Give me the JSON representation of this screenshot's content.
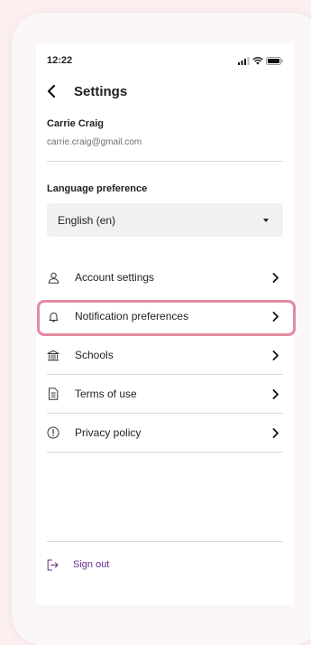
{
  "status_bar": {
    "time": "12:22"
  },
  "header": {
    "title": "Settings"
  },
  "user": {
    "name": "Carrie Craig",
    "email": "carrie.craig@gmail.com"
  },
  "language": {
    "label": "Language preference",
    "selected": "English (en)"
  },
  "menu": {
    "items": [
      {
        "label": "Account settings",
        "icon": "user-icon"
      },
      {
        "label": "Notification preferences",
        "icon": "bell-icon",
        "highlighted": true
      },
      {
        "label": "Schools",
        "icon": "school-building-icon"
      },
      {
        "label": "Terms of use",
        "icon": "document-icon"
      },
      {
        "label": "Privacy policy",
        "icon": "info-circle-icon"
      }
    ]
  },
  "sign_out": {
    "label": "Sign out",
    "icon": "sign-out-icon"
  },
  "colors": {
    "highlight": "#e48aa1",
    "sign_out_text": "#6b2c8c",
    "background": "#fcefef"
  }
}
